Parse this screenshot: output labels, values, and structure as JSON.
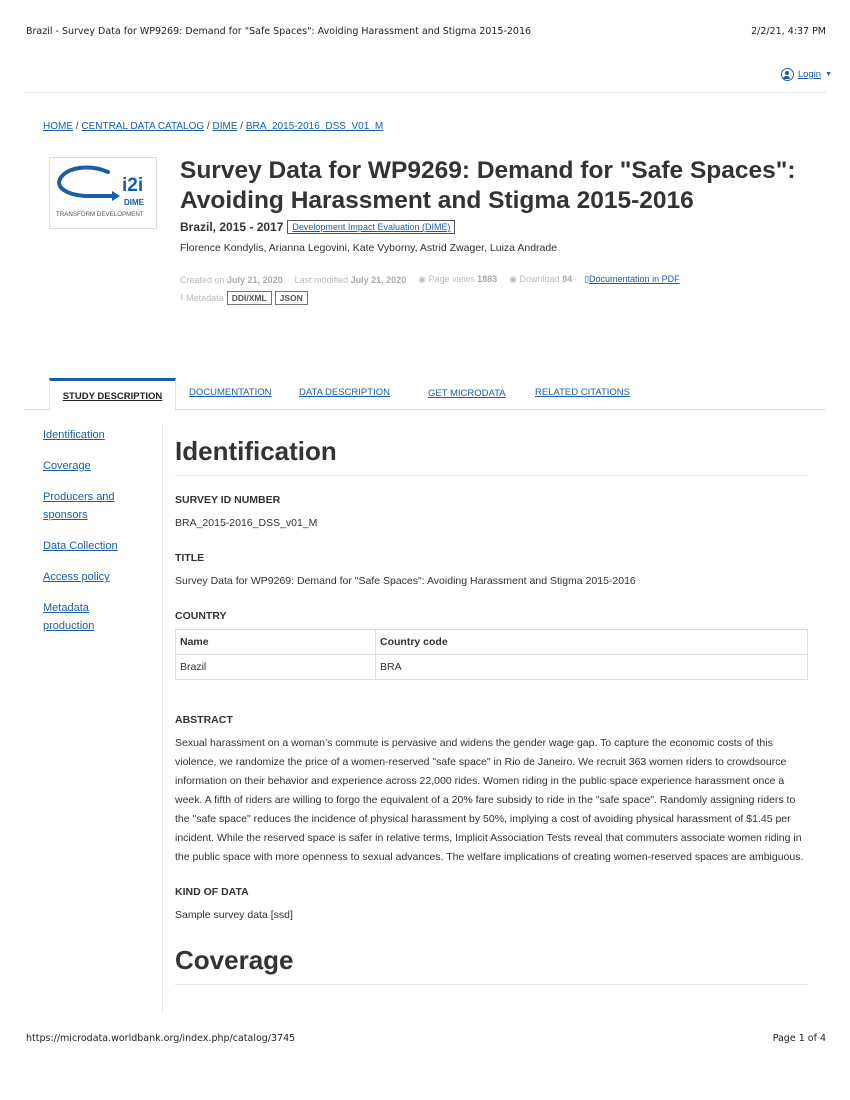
{
  "print": {
    "title": "Brazil - Survey Data for WP9269: Demand for \"Safe Spaces\": Avoiding Harassment and Stigma 2015-2016",
    "datetime": "2/2/21, 4:37 PM",
    "url": "https://microdata.worldbank.org/index.php/catalog/3745",
    "page": "Page 1 of 4"
  },
  "topbar": {
    "login_label": "Login",
    "icon": "user-circle-icon"
  },
  "breadcrumb": {
    "items": [
      "HOME",
      "CENTRAL DATA CATALOG",
      "DIME",
      "BRA_2015-2016_DSS_V01_M"
    ],
    "separator": " / "
  },
  "logo": {
    "main": "i2i",
    "sub": "DIME",
    "tagline": "TRANSFORM DEVELOPMENT"
  },
  "study": {
    "title": "Survey Data for WP9269: Demand for \"Safe Spaces\": Avoiding Harassment and Stigma 2015-2016",
    "country_years": "Brazil, 2015 - 2017",
    "badge": "Development Impact Evaluation (DIME)",
    "authors": "Florence Kondylis, Arianna Legovini, Kate Vyborny, Astrid Zwager, Luiza Andrade",
    "created_label": "Created on",
    "created_value": "July 21, 2020",
    "modified_label": "Last modified",
    "modified_value": "July 21, 2020",
    "views_label": "Page views",
    "views_value": "1883",
    "download_label": "Download",
    "download_value": "84",
    "doc_pdf": "Documentation in PDF",
    "metadata_label": "Metadata",
    "metadata_buttons": [
      "DDI/XML",
      "JSON"
    ]
  },
  "tabs": [
    "STUDY DESCRIPTION",
    "DOCUMENTATION",
    "DATA DESCRIPTION",
    "GET MICRODATA",
    "RELATED CITATIONS"
  ],
  "sidebar": {
    "items": [
      "Identification",
      "Coverage",
      "Producers and sponsors",
      "Data Collection",
      "Access policy",
      "Metadata production"
    ]
  },
  "identification": {
    "heading": "Identification",
    "survey_id_label": "SURVEY ID NUMBER",
    "survey_id_value": "BRA_2015-2016_DSS_v01_M",
    "title_label": "TITLE",
    "title_value": "Survey Data for WP9269: Demand for \"Safe Spaces\": Avoiding Harassment and Stigma 2015-2016",
    "country_label": "COUNTRY",
    "country_table": {
      "headers": [
        "Name",
        "Country code"
      ],
      "rows": [
        [
          "Brazil",
          "BRA"
        ]
      ]
    },
    "abstract_label": "ABSTRACT",
    "abstract_value": "Sexual harassment on a woman’s commute is pervasive and widens the gender wage gap. To capture the economic costs of this violence, we randomize the price of a women-reserved \"safe space\" in Rio de Janeiro. We recruit 363 women riders to crowdsource information on their behavior and experience across 22,000 rides. Women riding in the public space experience harassment once a week. A fifth of riders are willing to forgo the equivalent of a 20% fare subsidy to ride in the \"safe space\". Randomly assigning riders to the \"safe space\" reduces the incidence of physical harassment by 50%, implying a cost of avoiding physical harassment of $1.45 per incident. While the reserved space is safer in relative terms, Implicit Association Tests reveal that commuters associate women riding in the public space with more openness to sexual advances. The welfare implications of creating women-reserved spaces are ambiguous.",
    "kind_label": "KIND OF DATA",
    "kind_value": "Sample survey data [ssd]"
  },
  "coverage": {
    "heading": "Coverage"
  },
  "colors": {
    "link": "#1a5fa6",
    "text": "#333333",
    "logo_blue": "#1a5fa6"
  }
}
